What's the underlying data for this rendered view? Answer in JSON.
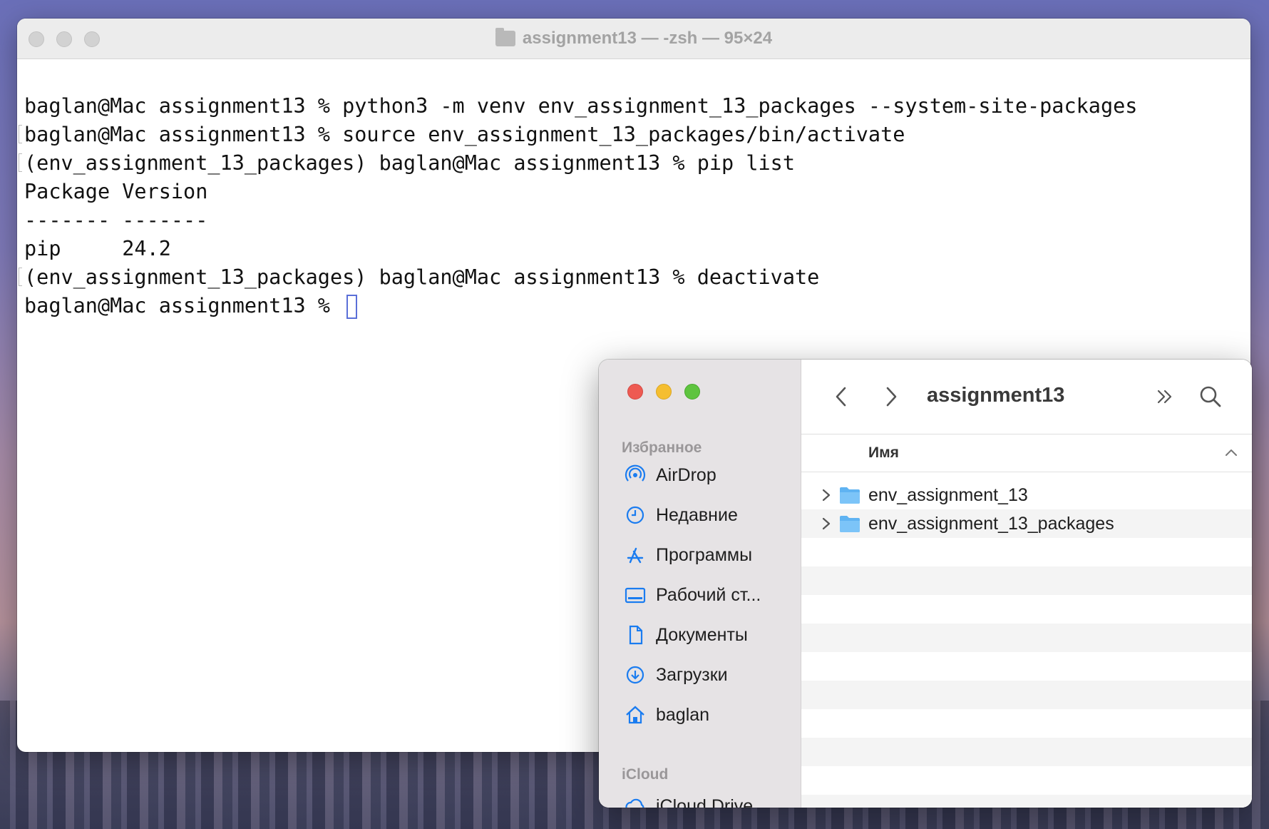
{
  "terminal": {
    "title": "assignment13 — -zsh — 95×24",
    "lines": [
      "baglan@Mac assignment13 % python3 -m venv env_assignment_13_packages --system-site-packages",
      "baglan@Mac assignment13 % source env_assignment_13_packages/bin/activate",
      "(env_assignment_13_packages) baglan@Mac assignment13 % pip list",
      "Package Version",
      "------- -------",
      "pip     24.2",
      "(env_assignment_13_packages) baglan@Mac assignment13 % deactivate"
    ],
    "prompt": "baglan@Mac assignment13 % ",
    "cursor_color": "#5a6fd8"
  },
  "finder": {
    "title": "assignment13",
    "sidebar": {
      "favorites_header": "Избранное",
      "items": [
        {
          "label": "AirDrop",
          "icon": "airdrop-icon"
        },
        {
          "label": "Недавние",
          "icon": "clock-icon"
        },
        {
          "label": "Программы",
          "icon": "applications-icon"
        },
        {
          "label": "Рабочий ст...",
          "icon": "desktop-icon"
        },
        {
          "label": "Документы",
          "icon": "document-icon"
        },
        {
          "label": "Загрузки",
          "icon": "downloads-icon"
        },
        {
          "label": "baglan",
          "icon": "home-icon"
        }
      ],
      "icloud_header": "iCloud",
      "icloud_items": [
        {
          "label": "iCloud Drive",
          "icon": "cloud-icon"
        }
      ]
    },
    "column_header": "Имя",
    "files": [
      {
        "name": "env_assignment_13",
        "type": "folder"
      },
      {
        "name": "env_assignment_13_packages",
        "type": "folder"
      }
    ],
    "accent_color": "#1a7cf0",
    "folder_color": "#5fb3f2"
  }
}
